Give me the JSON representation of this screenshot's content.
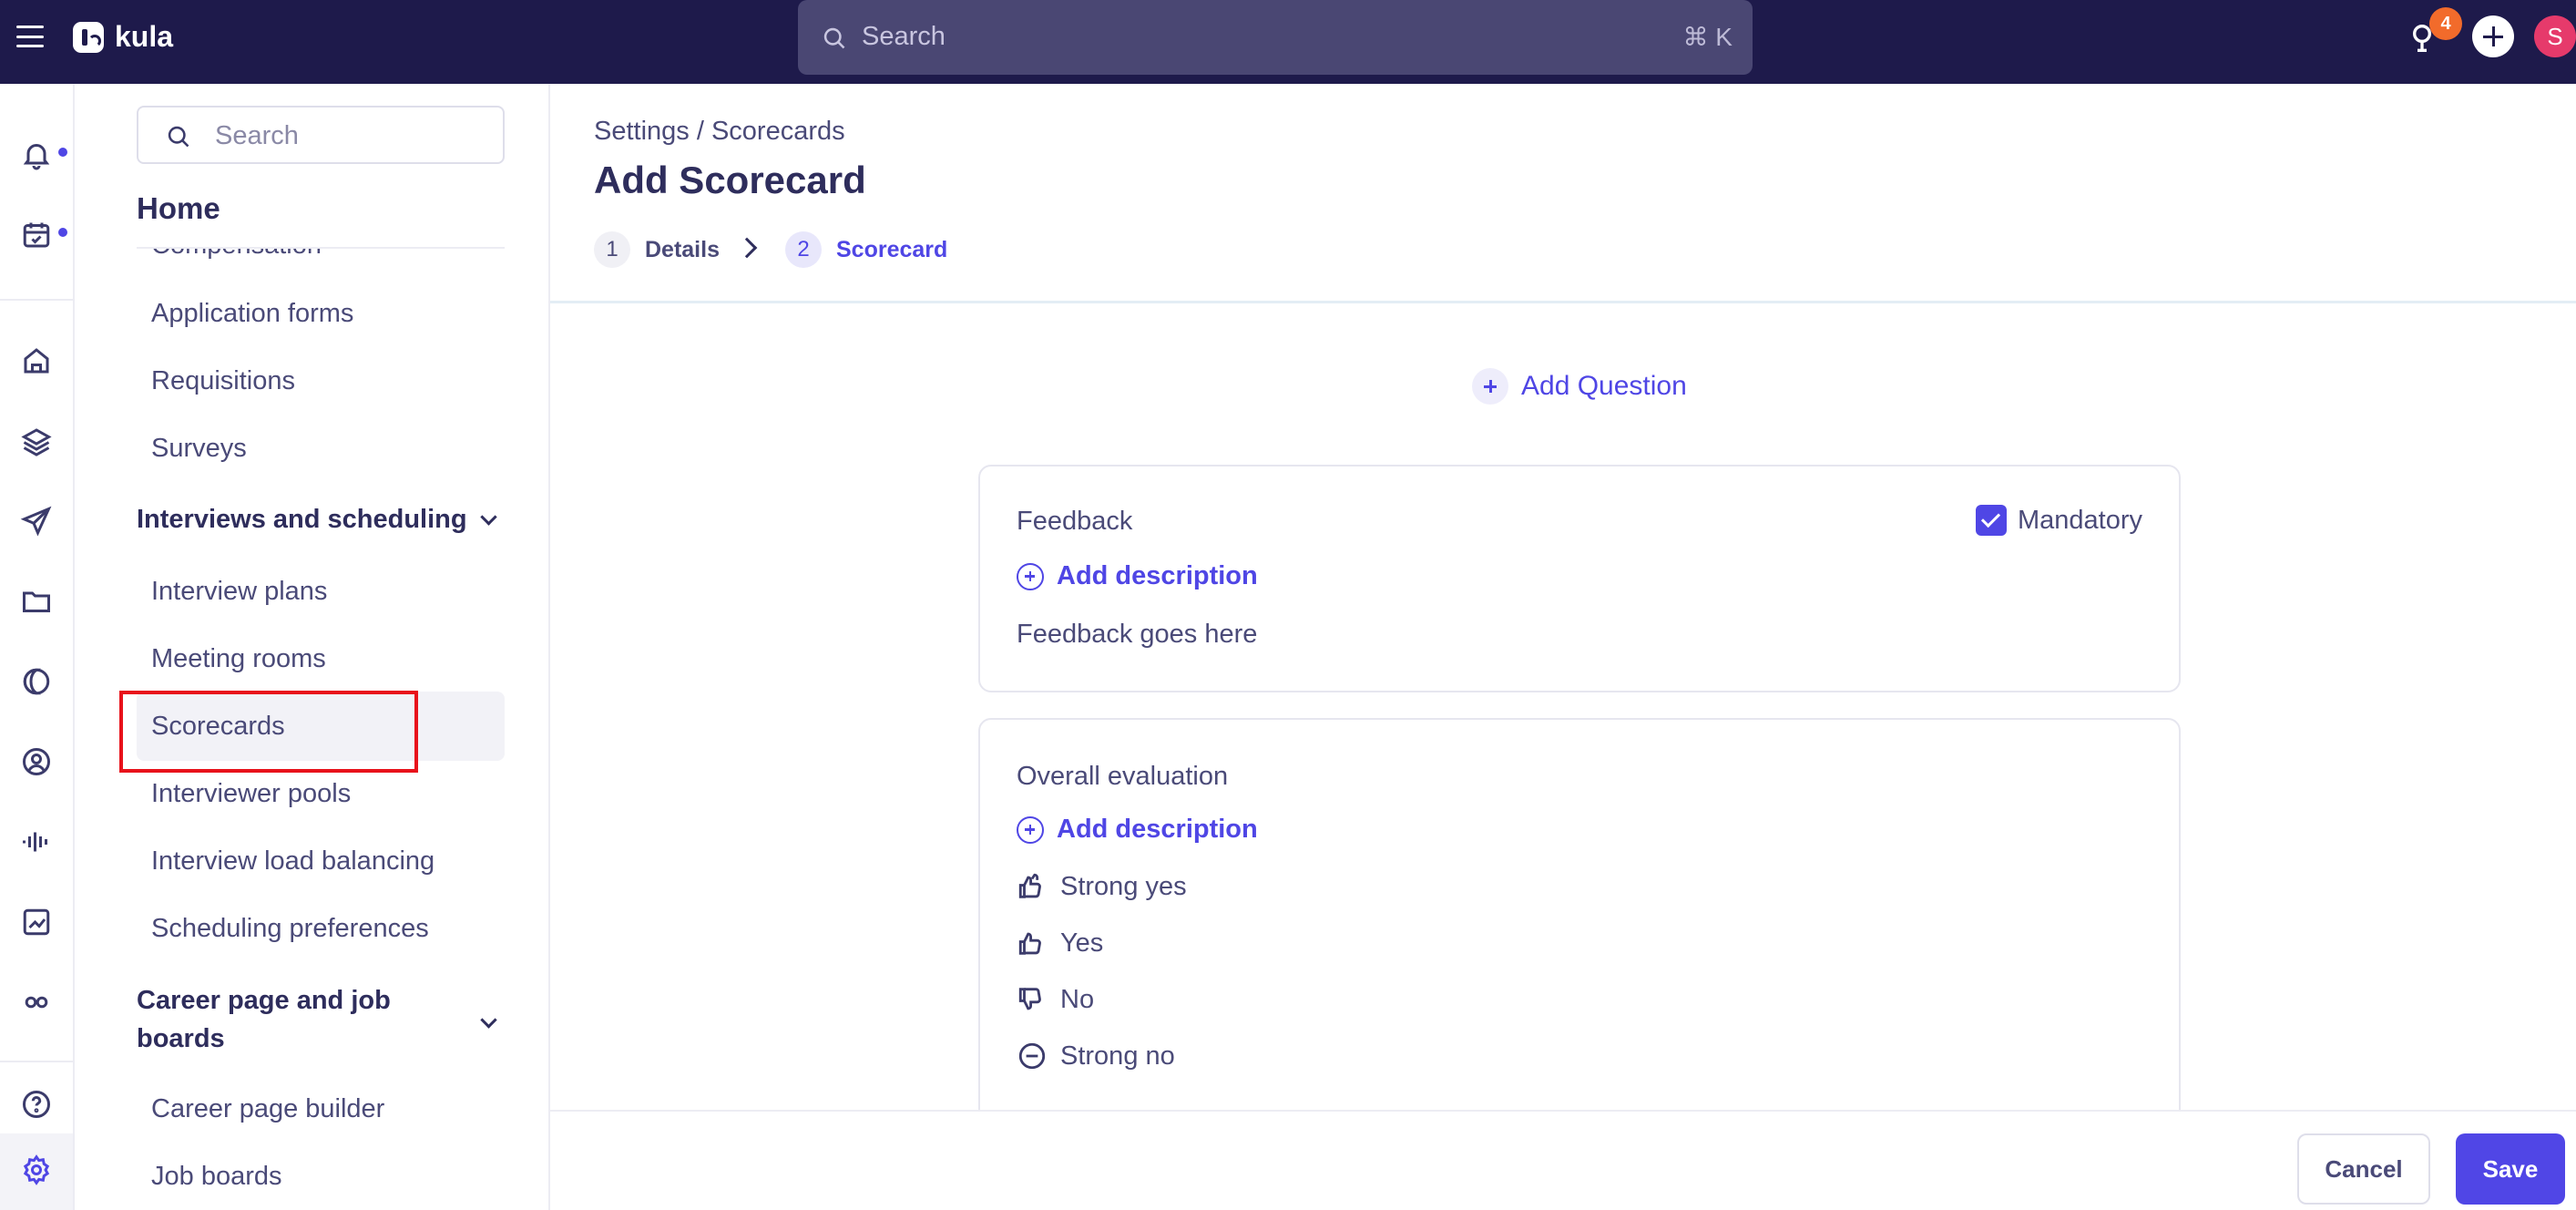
{
  "app": {
    "name": "kula"
  },
  "topbar": {
    "search_placeholder": "Search",
    "search_shortcut": "⌘ K",
    "notification_count": "4",
    "avatar_initial": "S"
  },
  "rail": {
    "icons": [
      "menu-icon",
      "bell-icon",
      "calendar-check-icon",
      "home-icon",
      "layers-icon",
      "send-icon",
      "folder-icon",
      "half-circle-icon",
      "user-circle-icon",
      "audio-wave-icon",
      "chart-icon",
      "infinity-icon",
      "help-icon",
      "gear-icon"
    ]
  },
  "sidebar": {
    "search_placeholder": "Search",
    "home_label": "Home",
    "items": [
      {
        "label": "Compensation"
      },
      {
        "label": "Application forms"
      },
      {
        "label": "Requisitions"
      },
      {
        "label": "Surveys"
      }
    ],
    "groups": [
      {
        "label": "Interviews and scheduling",
        "items": [
          {
            "label": "Interview plans"
          },
          {
            "label": "Meeting rooms"
          },
          {
            "label": "Scorecards"
          },
          {
            "label": "Interviewer pools"
          },
          {
            "label": "Interview load balancing"
          },
          {
            "label": "Scheduling preferences"
          }
        ]
      },
      {
        "label": "Career page and job boards",
        "items": [
          {
            "label": "Career page builder"
          },
          {
            "label": "Job boards"
          }
        ]
      }
    ],
    "active_item": "Scorecards"
  },
  "main": {
    "breadcrumb": "Settings / Scorecards",
    "title": "Add Scorecard",
    "steps": [
      {
        "num": "1",
        "label": "Details"
      },
      {
        "num": "2",
        "label": "Scorecard"
      }
    ],
    "add_question_label": "Add Question",
    "cards": [
      {
        "title": "Feedback",
        "mandatory_label": "Mandatory",
        "mandatory_checked": true,
        "add_description_label": "Add description",
        "body_text": "Feedback goes here"
      },
      {
        "title": "Overall evaluation",
        "add_description_label": "Add description",
        "options": [
          {
            "label": "Strong yes",
            "icon": "double-thumbs-up-icon"
          },
          {
            "label": "Yes",
            "icon": "thumbs-up-icon"
          },
          {
            "label": "No",
            "icon": "thumbs-down-icon"
          },
          {
            "label": "Strong no",
            "icon": "minus-circle-icon"
          }
        ]
      }
    ]
  },
  "footer": {
    "cancel_label": "Cancel",
    "save_label": "Save"
  },
  "colors": {
    "topbar_bg": "#1e1a4b",
    "accent": "#4f46e5",
    "notification_badge": "#f26b2b",
    "avatar": "#e63a6b",
    "highlight_box": "#e8121b"
  }
}
